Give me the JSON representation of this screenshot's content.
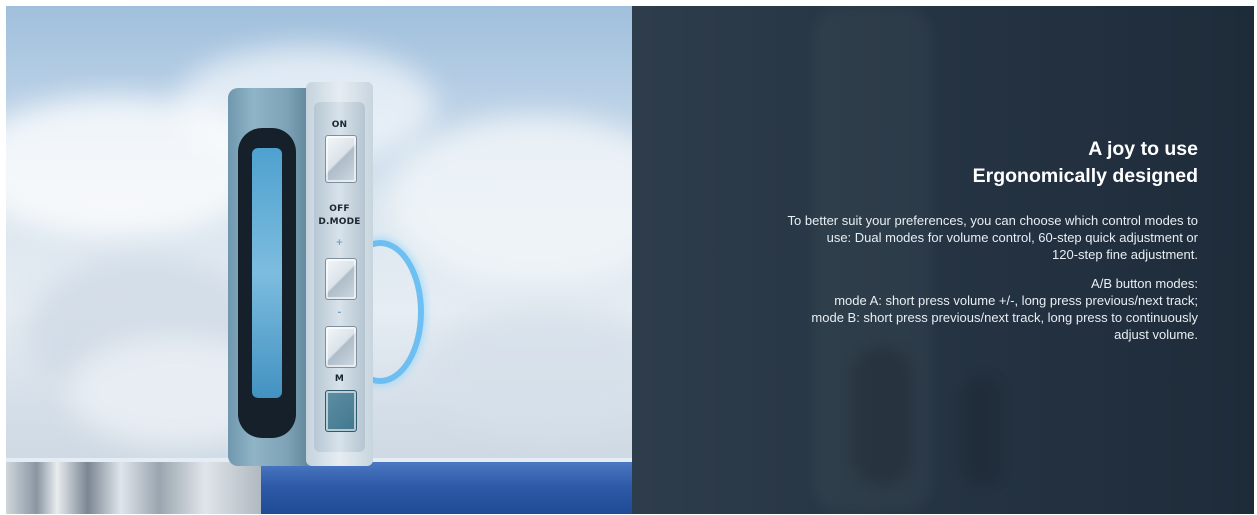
{
  "device": {
    "label_on": "ON",
    "label_off": "OFF",
    "label_dmode": "D.MODE",
    "label_plus": "+",
    "label_minus": "-",
    "label_m": "M"
  },
  "panel": {
    "heading_line1": "A joy to use",
    "heading_line2": "Ergonomically designed",
    "paragraph1": [
      "To better suit your preferences, you can choose which control modes to",
      "use: Dual modes for volume control, 60-step quick adjustment or",
      "120-step fine adjustment."
    ],
    "paragraph2": [
      "A/B button modes:",
      "mode A: short press volume +/-, long press previous/next track;",
      "mode B: short press previous/next track, long press to continuously",
      "adjust volume."
    ]
  },
  "colors": {
    "panel_bg": "#273644",
    "accent_blue": "#5ab8f2"
  }
}
